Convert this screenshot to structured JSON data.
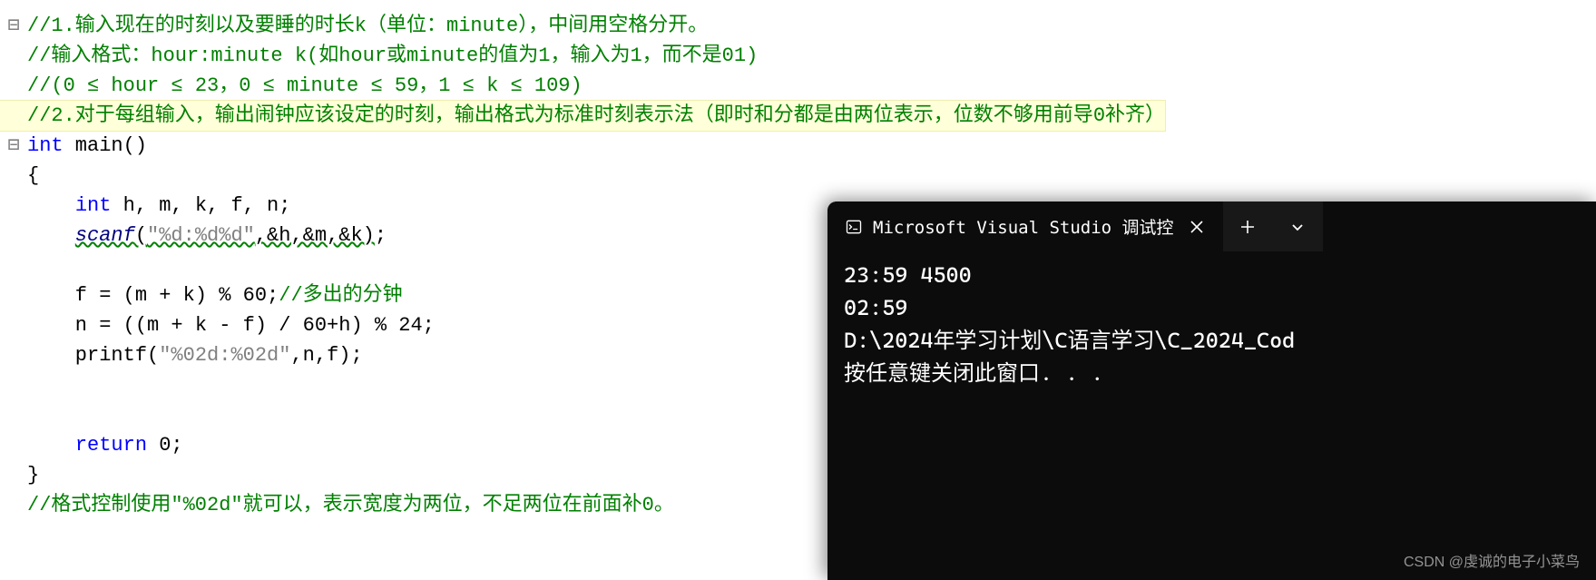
{
  "editor": {
    "lines": [
      {
        "gutter": "⊟",
        "content": [
          {
            "cls": "c-comment",
            "text": "//1.输入现在的时刻以及要睡的时长k（单位：minute），中间用空格分开。"
          }
        ]
      },
      {
        "gutter": "",
        "content": [
          {
            "cls": "c-comment",
            "text": "//输入格式：hour:minute k(如hour或minute的值为1，输入为1，而不是01)"
          }
        ]
      },
      {
        "gutter": "",
        "content": [
          {
            "cls": "c-comment",
            "text": "//(0 ≤ hour ≤ 23，0 ≤ minute ≤ 59，1 ≤ k ≤ 109)"
          }
        ]
      },
      {
        "gutter": "",
        "highlight": true,
        "content": [
          {
            "cls": "c-comment",
            "text": "//2.对于每组输入，输出闹钟应该设定的时刻，输出格式为标准时刻表示法（即时和分都是由两位表示，位数不够用前导0补齐）"
          }
        ]
      },
      {
        "gutter": "⊟",
        "content": [
          {
            "cls": "c-type",
            "text": "int"
          },
          {
            "cls": "c-default",
            "text": " main()"
          }
        ]
      },
      {
        "gutter": "",
        "content": [
          {
            "cls": "c-default",
            "text": "{"
          }
        ]
      },
      {
        "gutter": "",
        "content": [
          {
            "cls": "c-default",
            "text": "    "
          },
          {
            "cls": "c-type",
            "text": "int"
          },
          {
            "cls": "c-default",
            "text": " h, m, k, f, n;"
          }
        ]
      },
      {
        "gutter": "",
        "content": [
          {
            "cls": "c-default",
            "text": "    "
          },
          {
            "cls": "c-call squiggle",
            "text": "scanf"
          },
          {
            "cls": "c-default squiggle",
            "text": "("
          },
          {
            "cls": "c-string squiggle",
            "text": "\"%d:%d%d\""
          },
          {
            "cls": "c-default squiggle",
            "text": ",&h,&m,&k)"
          },
          {
            "cls": "c-default",
            "text": ";"
          }
        ]
      },
      {
        "gutter": "",
        "content": [
          {
            "cls": "c-default",
            "text": " "
          }
        ]
      },
      {
        "gutter": "",
        "content": [
          {
            "cls": "c-default",
            "text": "    f = (m + k) % 60;"
          },
          {
            "cls": "c-comment",
            "text": "//多出的分钟"
          }
        ]
      },
      {
        "gutter": "",
        "content": [
          {
            "cls": "c-default",
            "text": "    n = ((m + k - f) / 60+h) % 24;"
          }
        ]
      },
      {
        "gutter": "",
        "content": [
          {
            "cls": "c-default",
            "text": "    printf("
          },
          {
            "cls": "c-string",
            "text": "\"%02d:%02d\""
          },
          {
            "cls": "c-default",
            "text": ",n,f);"
          }
        ]
      },
      {
        "gutter": "",
        "content": [
          {
            "cls": "c-default",
            "text": " "
          }
        ]
      },
      {
        "gutter": "",
        "content": [
          {
            "cls": "c-default",
            "text": " "
          }
        ]
      },
      {
        "gutter": "",
        "content": [
          {
            "cls": "c-default",
            "text": "    "
          },
          {
            "cls": "c-keyword",
            "text": "return"
          },
          {
            "cls": "c-default",
            "text": " 0;"
          }
        ]
      },
      {
        "gutter": "",
        "content": [
          {
            "cls": "c-default",
            "text": "}"
          }
        ]
      },
      {
        "gutter": "",
        "content": [
          {
            "cls": "c-comment",
            "text": "//格式控制使用\"%02d\"就可以，表示宽度为两位，不足两位在前面补0。"
          }
        ]
      }
    ]
  },
  "terminal": {
    "tab_title": "Microsoft Visual Studio 调试控",
    "output_lines": [
      "23:59 4500",
      "02:59",
      "D:\\2024年学习计划\\C语言学习\\C_2024_Cod",
      "按任意键关闭此窗口. . ."
    ]
  },
  "watermark": "CSDN @虔诚的电子小菜鸟"
}
